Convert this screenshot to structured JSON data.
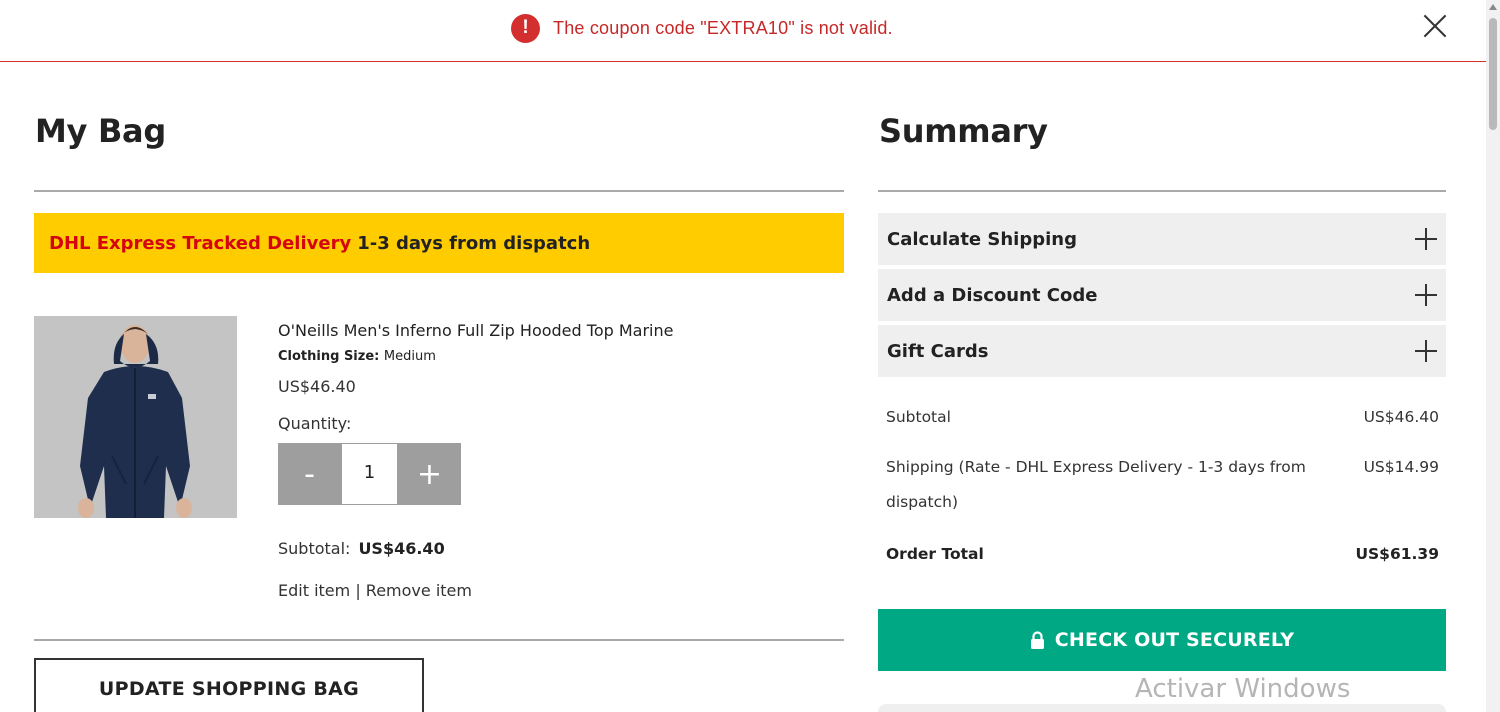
{
  "alert": {
    "icon": "exclamation-icon",
    "icon_glyph": "!",
    "message": "The coupon code \"EXTRA10\" is not valid.",
    "color": "#c62828"
  },
  "bag": {
    "title": "My Bag",
    "delivery": {
      "highlight": "DHL Express Tracked Delivery",
      "rest": "1-3 days from dispatch",
      "bg_color": "#ffcc00",
      "highlight_color": "#d40511"
    },
    "item": {
      "name": "O'Neills Men's Inferno Full Zip Hooded Top Marine",
      "size_label": "Clothing Size:",
      "size_value": "Medium",
      "price": "US$46.40",
      "quantity_label": "Quantity:",
      "minus": "-",
      "plus": "+",
      "quantity": "1",
      "subtotal_label": "Subtotal:",
      "subtotal_value": "US$46.40",
      "edit_label": "Edit item",
      "separator": "|",
      "remove_label": "Remove item"
    },
    "update_button": "UPDATE SHOPPING BAG"
  },
  "summary": {
    "title": "Summary",
    "accordions": [
      {
        "label": "Calculate Shipping"
      },
      {
        "label": "Add a Discount Code"
      },
      {
        "label": "Gift Cards"
      }
    ],
    "subtotal_label": "Subtotal",
    "subtotal_value": "US$46.40",
    "shipping_label": "Shipping (Rate - DHL Express Delivery - 1-3 days from dispatch)",
    "shipping_value": "US$14.99",
    "total_label": "Order Total",
    "total_value": "US$61.39",
    "checkout_button": "CHECK OUT SECURELY",
    "checkout_color": "#00a884"
  },
  "watermark": "Activar Windows"
}
